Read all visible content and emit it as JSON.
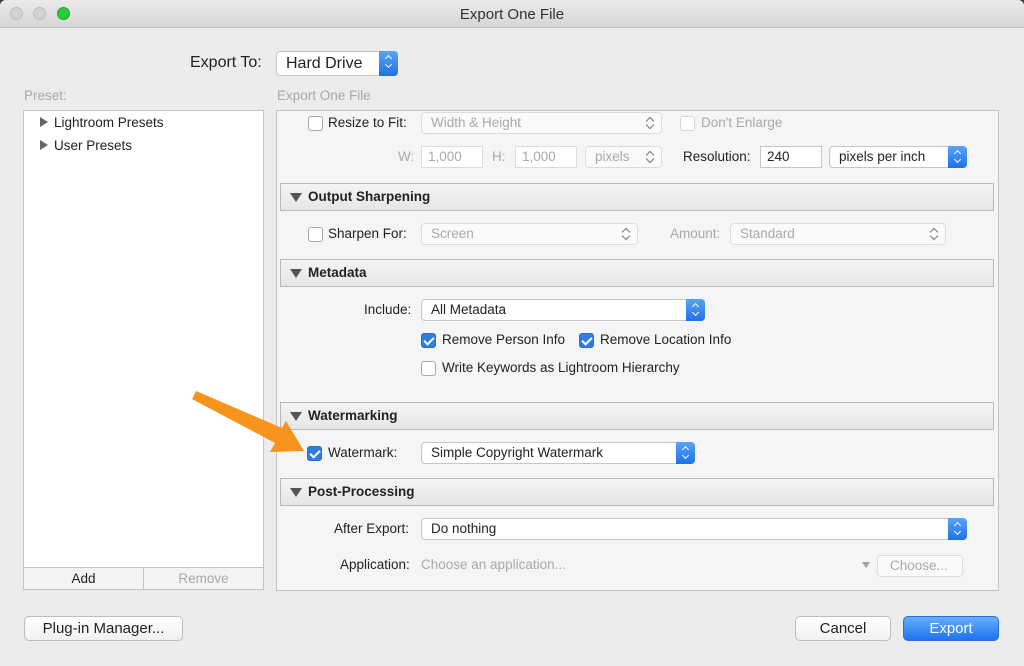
{
  "window": {
    "title": "Export One File"
  },
  "header": {
    "export_to_label": "Export To:",
    "export_to_value": "Hard Drive"
  },
  "presets": {
    "label": "Preset:",
    "items": [
      "Lightroom Presets",
      "User Presets"
    ],
    "add_label": "Add",
    "remove_label": "Remove"
  },
  "main": {
    "title": "Export One File",
    "sizing": {
      "resize_label": "Resize to Fit:",
      "resize_checked": false,
      "resize_mode": "Width & Height",
      "dont_enlarge_label": "Don't Enlarge",
      "w_label": "W:",
      "w_value": "1,000",
      "h_label": "H:",
      "h_value": "1,000",
      "unit": "pixels",
      "resolution_label": "Resolution:",
      "resolution_value": "240",
      "resolution_unit": "pixels per inch"
    },
    "output_sharpening": {
      "header": "Output Sharpening",
      "sharpen_label": "Sharpen For:",
      "sharpen_checked": false,
      "sharpen_value": "Screen",
      "amount_label": "Amount:",
      "amount_value": "Standard"
    },
    "metadata": {
      "header": "Metadata",
      "include_label": "Include:",
      "include_value": "All Metadata",
      "remove_person_label": "Remove Person Info",
      "remove_person_checked": true,
      "remove_location_label": "Remove Location Info",
      "remove_location_checked": true,
      "write_keywords_label": "Write Keywords as Lightroom Hierarchy",
      "write_keywords_checked": false
    },
    "watermarking": {
      "header": "Watermarking",
      "watermark_label": "Watermark:",
      "watermark_checked": true,
      "watermark_value": "Simple Copyright Watermark"
    },
    "post_processing": {
      "header": "Post-Processing",
      "after_export_label": "After Export:",
      "after_export_value": "Do nothing",
      "application_label": "Application:",
      "application_placeholder": "Choose an application...",
      "choose_label": "Choose..."
    }
  },
  "footer": {
    "plugin_manager_label": "Plug-in Manager...",
    "cancel_label": "Cancel",
    "export_label": "Export"
  },
  "colors": {
    "accent": "#2f7de1",
    "annotation_arrow": "#f7941d"
  }
}
